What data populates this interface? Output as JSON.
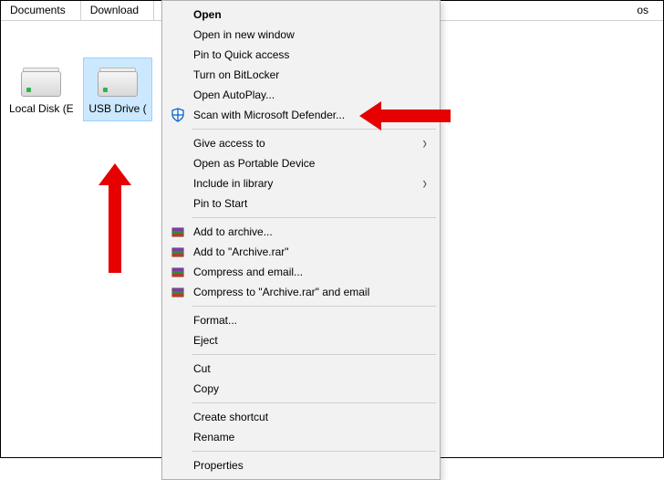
{
  "tabs": {
    "t0": "Documents",
    "t1": "Download",
    "t2": "os"
  },
  "drives": {
    "d0": {
      "label": "Local Disk (E:)"
    },
    "d1": {
      "label": "USB Drive ("
    }
  },
  "menu": {
    "open": "Open",
    "open_new_window": "Open in new window",
    "pin_quick_access": "Pin to Quick access",
    "bitlocker": "Turn on BitLocker",
    "autoplay": "Open AutoPlay...",
    "defender": "Scan with Microsoft Defender...",
    "give_access": "Give access to",
    "portable": "Open as Portable Device",
    "include_library": "Include in library",
    "pin_start": "Pin to Start",
    "add_archive": "Add to archive...",
    "add_archive_rar": "Add to \"Archive.rar\"",
    "compress_email": "Compress and email...",
    "compress_archive_email": "Compress to \"Archive.rar\" and email",
    "format": "Format...",
    "eject": "Eject",
    "cut": "Cut",
    "copy": "Copy",
    "create_shortcut": "Create shortcut",
    "rename": "Rename",
    "properties": "Properties"
  }
}
